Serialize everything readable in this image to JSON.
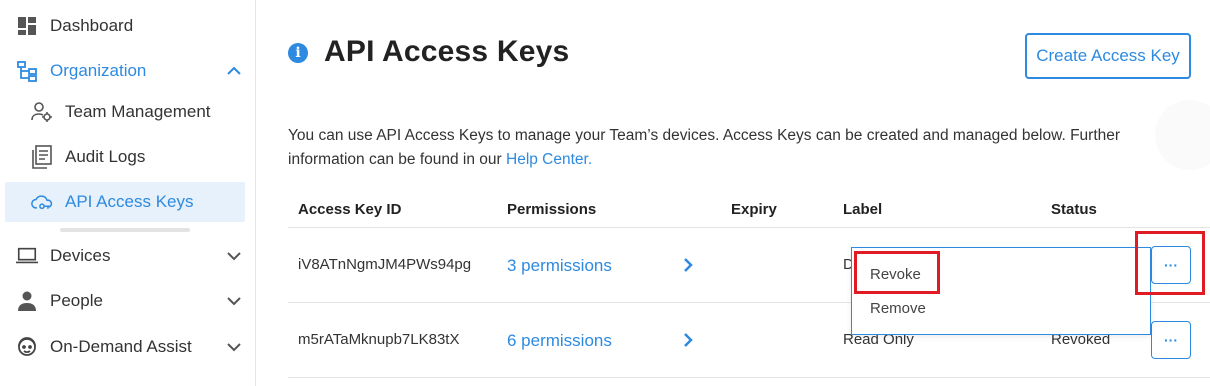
{
  "sidebar": {
    "items": [
      {
        "label": "Dashboard"
      },
      {
        "label": "Organization"
      },
      {
        "label": "Team Management"
      },
      {
        "label": "Audit Logs"
      },
      {
        "label": "API Access Keys"
      },
      {
        "label": "Devices"
      },
      {
        "label": "People"
      },
      {
        "label": "On-Demand Assist"
      }
    ]
  },
  "header": {
    "title": "API Access Keys",
    "info_icon": "i",
    "create_button": "Create Access Key"
  },
  "description": {
    "text": "You can use API Access Keys to manage your Team’s devices. Access Keys can be created and managed below. Further information can be found in our ",
    "link": "Help Center."
  },
  "table": {
    "columns": [
      "Access Key ID",
      "Permissions",
      "Expiry",
      "Label",
      "Status"
    ],
    "rows": [
      {
        "id": "iV8ATnNgmJM4PWs94pg",
        "permissions": "3 permissions",
        "expiry": "",
        "label": "D",
        "status": ""
      },
      {
        "id": "m5rATaMknupb7LK83tX",
        "permissions": "6 permissions",
        "expiry": "",
        "label": "Read Only",
        "status": "Revoked"
      }
    ],
    "more_label": "···"
  },
  "dropdown": {
    "items": [
      "Revoke",
      "Remove"
    ]
  },
  "colors": {
    "accent": "#2d8ae0",
    "highlight": "#e01b24"
  }
}
